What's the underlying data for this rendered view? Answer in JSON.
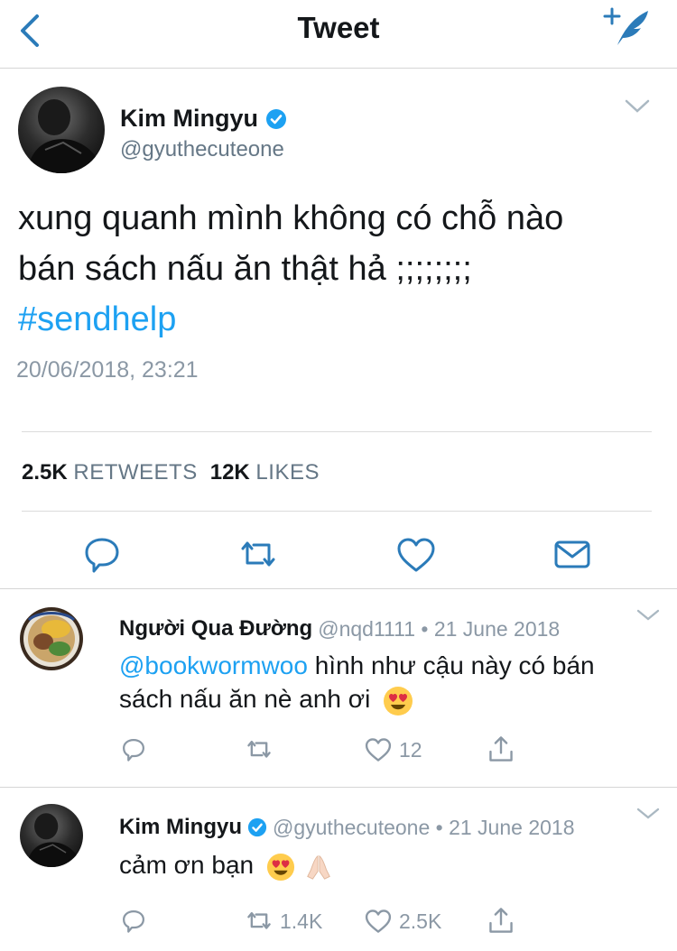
{
  "header": {
    "title": "Tweet",
    "back_icon": "chevron-left-icon",
    "compose_icon": "compose-quill-icon"
  },
  "tweet": {
    "author_name": "Kim Mingyu",
    "author_handle": "@gyuthecuteone",
    "text_line1": "xung quanh mình không có chỗ nào",
    "text_line2": "bán sách nấu ăn thật hả ;;;;;;;;",
    "hashtag": "#sendhelp",
    "timestamp": "20/06/2018, 23:21",
    "retweets_count": "2.5K",
    "retweets_label": "RETWEETS",
    "likes_count": "12K",
    "likes_label": "LIKES"
  },
  "replies": [
    {
      "author_name": "Người Qua Đường",
      "meta": "@nqd1111 • 21 June 2018",
      "mention": "@bookwormwoo",
      "text_a": " hình như cậu này có bán",
      "text_b": "sách nấu ăn nè anh ơi",
      "retweets": "",
      "likes": "12"
    },
    {
      "author_name": "Kim Mingyu",
      "meta": "@gyuthecuteone • 21 June 2018",
      "text": "cảm ơn bạn",
      "retweets": "1.4K",
      "likes": "2.5K"
    }
  ],
  "colors": {
    "accent": "#1da1f2",
    "icon": "#2b7bb9",
    "muted": "#8b98a5",
    "verified": "#1da1f2"
  },
  "icons": [
    "chevron-left-icon",
    "compose-quill-icon",
    "verified-badge-icon",
    "chevron-down-icon",
    "reply-icon",
    "retweet-icon",
    "like-heart-icon",
    "message-icon",
    "share-icon",
    "heart-eyes-emoji",
    "folded-hands-emoji"
  ]
}
